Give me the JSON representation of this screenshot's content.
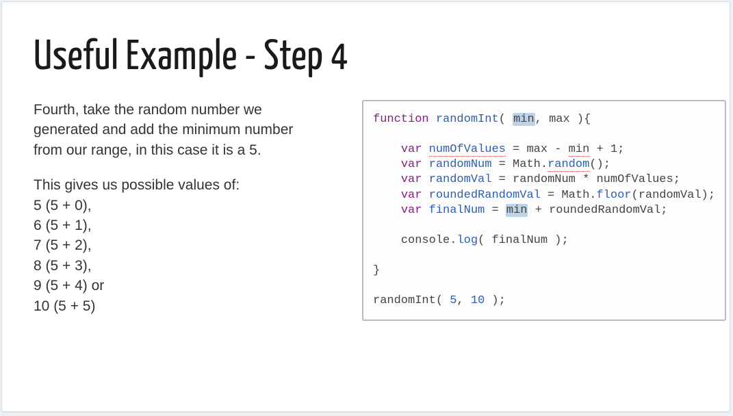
{
  "title": "Useful Example - Step 4",
  "left": {
    "para1": "Fourth, take the random number we generated and add the minimum number from our range, in this case it is a 5.",
    "para2_intro": "This gives us possible values of:",
    "vals": [
      "5 (5 + 0),",
      "6 (5 + 1),",
      "7 (5 + 2),",
      "8 (5 + 3),",
      "9 (5 + 4) or",
      "10 (5 + 5)"
    ]
  },
  "code": {
    "kw_function": "function",
    "fn_name": "randomInt",
    "param_open": "( ",
    "param_min": "min",
    "param_sep": ", ",
    "param_max": "max",
    "param_close": " ){",
    "kw_var": "var",
    "v_numOfValues": "numOfValues",
    "eq_max_minus": " = max - ",
    "text_min": "min",
    "plus1": " + 1;",
    "v_randomNum": "randomNum",
    "eq_math": " = Math.",
    "mth_random": "random",
    "call_empty": "();",
    "v_randomVal": "randomVal",
    "eq_rn_times_nov": " = randomNum * numOfValues;",
    "v_roundedRandomVal": "roundedRandomVal",
    "eq_math2": " = Math.",
    "mth_floor": "floor",
    "call_rv": "(randomVal);",
    "v_finalNum": "finalNum",
    "eq_sp": " = ",
    "hl_min2": "min",
    "plus_rrv": " + roundedRandomVal;",
    "consolelog": "console.",
    "mth_log": "log",
    "call_fn": "( finalNum );",
    "brace_close": "}",
    "call_randomInt": "randomInt( ",
    "num5": "5",
    "sep": ", ",
    "num10": "10",
    "call_end": " );"
  }
}
